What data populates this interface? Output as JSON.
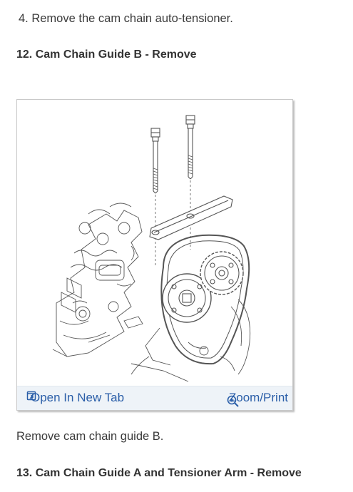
{
  "steps": {
    "prev_step": "4. Remove the cam chain auto-tensioner.",
    "section12_title": "12. Cam Chain Guide B - Remove",
    "section12_instruction": "Remove cam chain guide B.",
    "section13_title": "13. Cam Chain Guide A and Tensioner Arm - Remove"
  },
  "figure": {
    "open_label": "Open In New Tab",
    "zoom_label": "Zoom/Print",
    "open_icon": "open-new-tab-icon",
    "zoom_icon": "magnifier-plus-icon",
    "link_color": "#2a5ea8"
  }
}
